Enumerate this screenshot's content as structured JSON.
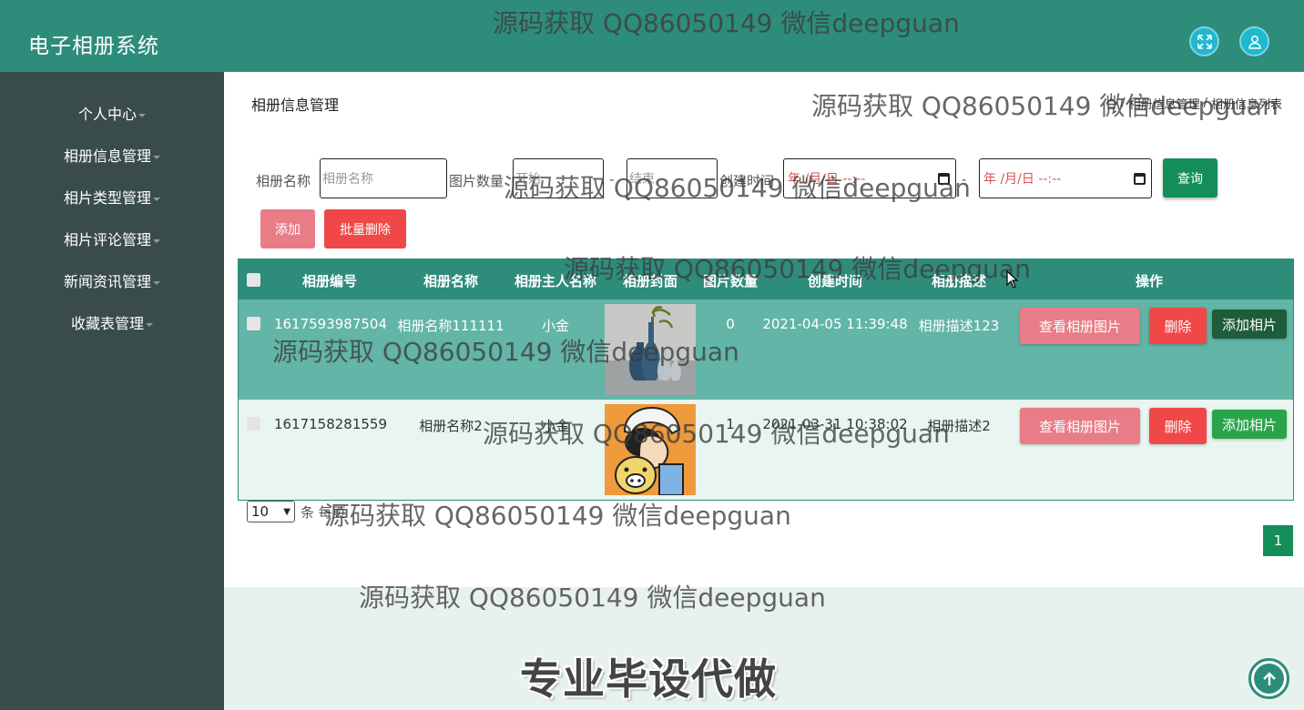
{
  "app": {
    "title": "电子相册系统"
  },
  "header": {
    "fullscreen_icon": "expand-icon",
    "user_icon": "user-icon"
  },
  "sidebar": {
    "items": [
      {
        "label": "个人中心"
      },
      {
        "label": "相册信息管理"
      },
      {
        "label": "相片类型管理"
      },
      {
        "label": "相片评论管理"
      },
      {
        "label": "新闻资讯管理"
      },
      {
        "label": "收藏表管理"
      }
    ]
  },
  "page": {
    "title": "相册信息管理",
    "breadcrumb": {
      "home_icon": "home-icon",
      "level1": "相册信息管理",
      "separator": "/",
      "level2": "相册信息列表"
    }
  },
  "search": {
    "name_label": "相册名称",
    "name_placeholder": "相册名称",
    "count_label": "图片数量",
    "count_start_placeholder": "开始",
    "count_sep": "-",
    "count_end_placeholder": "结束",
    "time_label": "创建时间",
    "date_placeholder": "年 /月/日 --:--",
    "time_sep": "-",
    "query_button": "查询"
  },
  "actions": {
    "add_button": "添加",
    "batch_delete_button": "批量删除"
  },
  "table": {
    "columns": [
      "相册编号",
      "相册名称",
      "相册主人名称",
      "相册封面",
      "图片数量",
      "创建时间",
      "相册描述",
      "操作"
    ],
    "rows": [
      {
        "id": "1617593987504",
        "name": "相册名称111111",
        "owner": "小金",
        "cover": "vases-photo",
        "count": "0",
        "created": "2021-04-05 11:39:48",
        "desc": "相册描述123"
      },
      {
        "id": "1617158281559",
        "name": "相册名称2",
        "owner": "小金",
        "cover": "cartoon-photo",
        "count": "1",
        "created": "2021-03-31 10:38:02",
        "desc": "相册描述2"
      }
    ],
    "row_actions": {
      "view": "查看相册图片",
      "delete": "删除",
      "add_photo": "添加相片"
    }
  },
  "pagination": {
    "page_size": "10",
    "unit_text": "条 每页",
    "current_page": "1"
  },
  "watermarks": [
    "源码获取 QQ86050149 微信deepguan",
    "专业毕设代做"
  ],
  "colors": {
    "primary": "#2e8c7b",
    "sidebar": "#3a4b4c",
    "danger": "#f04848",
    "pink": "#e87d87",
    "success": "#148f5a"
  }
}
